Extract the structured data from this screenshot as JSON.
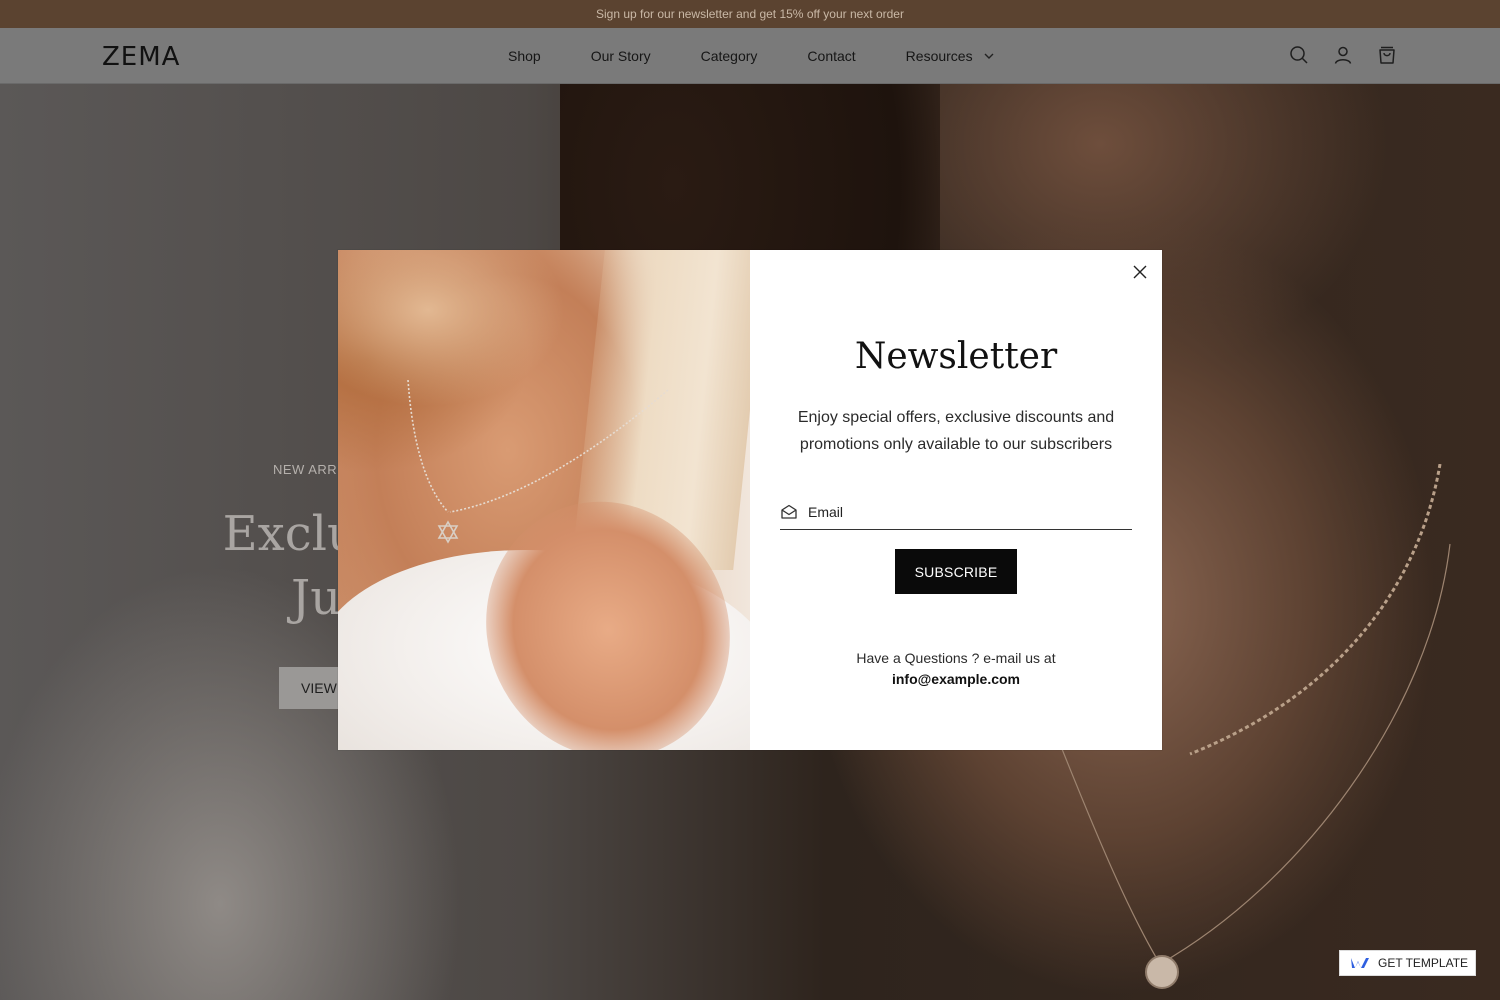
{
  "announcement": {
    "text": "Sign up for our newsletter and get 15% off your next order"
  },
  "header": {
    "logo": "ZEMA",
    "nav": [
      {
        "label": "Shop"
      },
      {
        "label": "Our Story"
      },
      {
        "label": "Category"
      },
      {
        "label": "Contact"
      },
      {
        "label": "Resources",
        "has_dropdown": true
      }
    ],
    "icons": [
      "search-icon",
      "user-icon",
      "cart-icon"
    ]
  },
  "hero": {
    "label": "NEW ARRI",
    "title_line1": "Exclusive",
    "title_line2": "Just",
    "button_label": "VIEW"
  },
  "modal": {
    "title": "Newsletter",
    "description": "Enjoy special offers, exclusive discounts and promotions only available to our subscribers",
    "email_placeholder": "Email",
    "subscribe_label": "SUBSCRIBE",
    "contact_text": "Have a Questions ? e-mail us at",
    "contact_email": "info@example.com"
  },
  "badge": {
    "label": "GET TEMPLATE"
  },
  "colors": {
    "announcement_bg": "#5b4330",
    "button_bg": "#0a0a0a",
    "badge_icon": "#2f5fe0"
  }
}
